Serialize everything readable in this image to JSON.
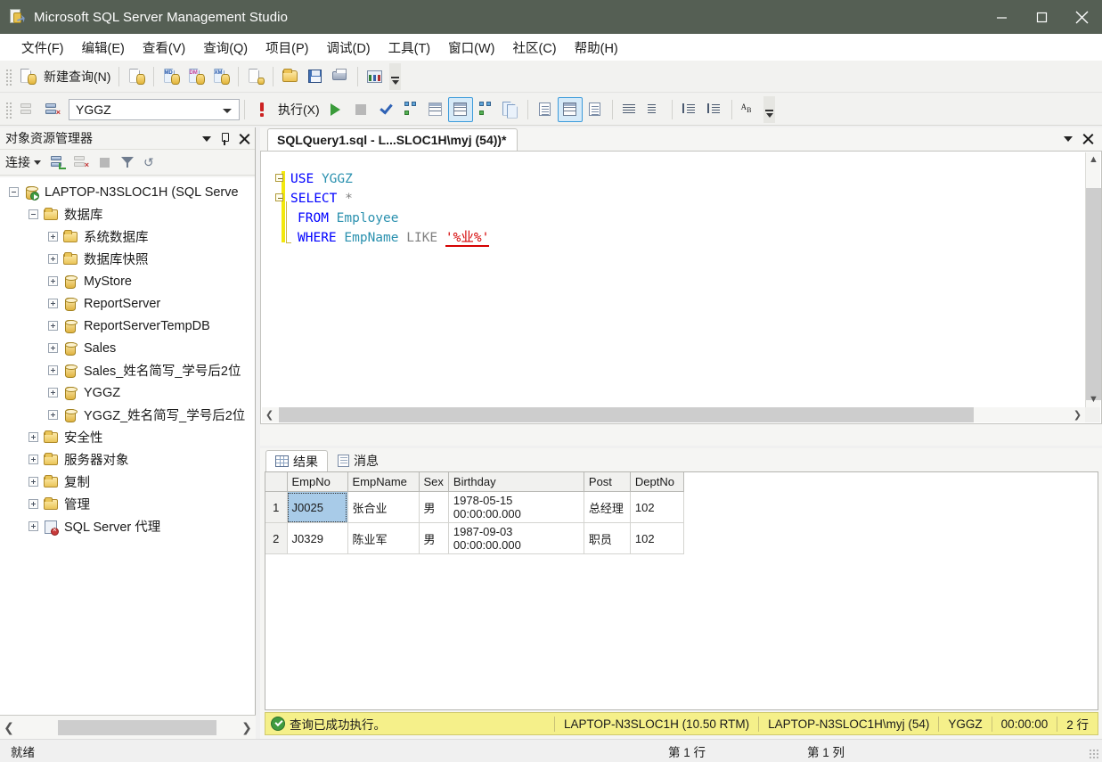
{
  "window": {
    "title": "Microsoft SQL Server Management Studio",
    "icon": "ssms-app-icon",
    "controls": {
      "minimize": "minimize-button",
      "maximize": "maximize-button",
      "close": "close-button"
    }
  },
  "menubar": {
    "items": [
      {
        "label": "文件(F)",
        "name": "menu-file"
      },
      {
        "label": "编辑(E)",
        "name": "menu-edit"
      },
      {
        "label": "查看(V)",
        "name": "menu-view"
      },
      {
        "label": "查询(Q)",
        "name": "menu-query"
      },
      {
        "label": "项目(P)",
        "name": "menu-project"
      },
      {
        "label": "调试(D)",
        "name": "menu-debug"
      },
      {
        "label": "工具(T)",
        "name": "menu-tools"
      },
      {
        "label": "窗口(W)",
        "name": "menu-window"
      },
      {
        "label": "社区(C)",
        "name": "menu-community"
      },
      {
        "label": "帮助(H)",
        "name": "menu-help"
      }
    ]
  },
  "toolbar_standard": {
    "new_query_label": "新建查询(N)",
    "icons": [
      "new-query-icon",
      "new-file-icon",
      "new-analysis-query-icon",
      "new-mdx-query-icon",
      "new-dmx-query-icon",
      "new-xmla-query-icon",
      "open-file-icon",
      "save-icon",
      "print-icon",
      "activity-monitor-icon",
      "toolbar-overflow-icon"
    ]
  },
  "toolbar_query": {
    "database_selector_value": "YGGZ",
    "execute_label": "执行(X)",
    "icons": [
      "available-databases-icon",
      "change-connection-icon",
      "execute-bang-icon",
      "execute-play-icon",
      "stop-icon",
      "parse-check-icon",
      "display-estimated-plan-icon",
      "query-options-icon",
      "results-to-grid-icon",
      "include-actual-plan-icon",
      "include-client-statistics-icon",
      "results-to-text-icon",
      "results-to-grid-selected-icon",
      "results-to-file-icon",
      "comment-icon",
      "uncomment-icon",
      "decrease-indent-icon",
      "increase-indent-icon",
      "find-replace-icon",
      "toolbar-overflow-icon"
    ]
  },
  "object_explorer": {
    "title": "对象资源管理器",
    "header_icons": [
      "window-dropdown-icon",
      "pin-icon",
      "close-icon"
    ],
    "toolbar": {
      "connect_label": "连接",
      "icons": [
        "connect-icon",
        "disconnect-icon",
        "stop-icon",
        "filter-icon",
        "refresh-icon"
      ]
    },
    "tree": [
      {
        "label": "LAPTOP-N3SLOC1H (SQL Serve",
        "indent": 0,
        "expander": "minus",
        "icon": "server-icon",
        "name": "tree-node-server"
      },
      {
        "label": "数据库",
        "indent": 1,
        "expander": "minus",
        "icon": "folder-icon",
        "name": "tree-node-databases"
      },
      {
        "label": "系统数据库",
        "indent": 2,
        "expander": "plus",
        "icon": "folder-icon",
        "name": "tree-node-system-databases"
      },
      {
        "label": "数据库快照",
        "indent": 2,
        "expander": "plus",
        "icon": "folder-icon",
        "name": "tree-node-database-snapshots"
      },
      {
        "label": "MyStore",
        "indent": 2,
        "expander": "plus",
        "icon": "database-icon",
        "name": "tree-node-mystore"
      },
      {
        "label": "ReportServer",
        "indent": 2,
        "expander": "plus",
        "icon": "database-icon",
        "name": "tree-node-reportserver"
      },
      {
        "label": "ReportServerTempDB",
        "indent": 2,
        "expander": "plus",
        "icon": "database-icon",
        "name": "tree-node-reportservertempdb"
      },
      {
        "label": "Sales",
        "indent": 2,
        "expander": "plus",
        "icon": "database-icon",
        "name": "tree-node-sales"
      },
      {
        "label": "Sales_姓名简写_学号后2位",
        "indent": 2,
        "expander": "plus",
        "icon": "database-icon",
        "name": "tree-node-sales-student"
      },
      {
        "label": "YGGZ",
        "indent": 2,
        "expander": "plus",
        "icon": "database-icon",
        "name": "tree-node-yggz"
      },
      {
        "label": "YGGZ_姓名简写_学号后2位",
        "indent": 2,
        "expander": "plus",
        "icon": "database-icon",
        "name": "tree-node-yggz-student"
      },
      {
        "label": "安全性",
        "indent": 1,
        "expander": "plus",
        "icon": "folder-icon",
        "name": "tree-node-security"
      },
      {
        "label": "服务器对象",
        "indent": 1,
        "expander": "plus",
        "icon": "folder-icon",
        "name": "tree-node-server-objects"
      },
      {
        "label": "复制",
        "indent": 1,
        "expander": "plus",
        "icon": "folder-icon",
        "name": "tree-node-replication"
      },
      {
        "label": "管理",
        "indent": 1,
        "expander": "plus",
        "icon": "folder-icon",
        "name": "tree-node-management"
      },
      {
        "label": "SQL Server 代理",
        "indent": 1,
        "expander": "plus",
        "icon": "sql-agent-icon",
        "name": "tree-node-sql-server-agent"
      }
    ]
  },
  "editor": {
    "tab_label": "SQLQuery1.sql - L...SLOC1H\\myj (54))*",
    "lines": [
      {
        "fold": "minus",
        "tokens": [
          {
            "t": "USE",
            "c": "kw"
          },
          {
            "t": " ",
            "c": "op"
          },
          {
            "t": "YGGZ",
            "c": "idn"
          }
        ]
      },
      {
        "fold": "minus",
        "tokens": [
          {
            "t": "SELECT",
            "c": "kw"
          },
          {
            "t": " ",
            "c": "op"
          },
          {
            "t": "*",
            "c": "op"
          }
        ]
      },
      {
        "fold": "none",
        "tokens": [
          {
            "t": "FROM",
            "c": "kw"
          },
          {
            "t": " ",
            "c": "op"
          },
          {
            "t": "Employee",
            "c": "idn"
          }
        ]
      },
      {
        "fold": "end",
        "tokens": [
          {
            "t": "WHERE",
            "c": "kw"
          },
          {
            "t": " ",
            "c": "op"
          },
          {
            "t": "EmpName",
            "c": "idn"
          },
          {
            "t": " ",
            "c": "op"
          },
          {
            "t": "LIKE",
            "c": "op"
          },
          {
            "t": " ",
            "c": "op"
          },
          {
            "t": "'%业%'",
            "c": "str sq"
          }
        ]
      }
    ],
    "full_text": "USE YGGZ\nSELECT *\n  FROM Employee\n  WHERE EmpName LIKE '%业%'"
  },
  "results": {
    "tabs": [
      {
        "label": "结果",
        "icon": "results-grid-icon",
        "active": true,
        "name": "tab-results"
      },
      {
        "label": "消息",
        "icon": "messages-icon",
        "active": false,
        "name": "tab-messages"
      }
    ],
    "columns": [
      "EmpNo",
      "EmpName",
      "Sex",
      "Birthday",
      "Post",
      "DeptNo"
    ],
    "rows": [
      {
        "num": "1",
        "cells": [
          "J0025",
          "张合业",
          "男",
          "1978-05-15 00:00:00.000",
          "总经理",
          "102"
        ]
      },
      {
        "num": "2",
        "cells": [
          "J0329",
          "陈业军",
          "男",
          "1987-09-03 00:00:00.000",
          "职员",
          "102"
        ]
      }
    ],
    "selected_cell": {
      "row": 0,
      "col": 0
    },
    "status": {
      "icon": "success-icon",
      "message": "查询已成功执行。",
      "server": "LAPTOP-N3SLOC1H (10.50 RTM)",
      "user": "LAPTOP-N3SLOC1H\\myj (54)",
      "database": "YGGZ",
      "elapsed": "00:00:00",
      "rowcount": "2 行"
    }
  },
  "statusbar": {
    "ready": "就绪",
    "line": "第 1 行",
    "column": "第 1 列"
  },
  "colors": {
    "titlebar": "#555f54",
    "accent_selected": "#3c9bdb",
    "status_yellow": "#f5f08a",
    "keyword_blue": "#0000ff",
    "identifier_teal": "#2b91af",
    "string_red": "#d40000",
    "change_bar_yellow": "#f2e80c",
    "grid_selection": "#a8cbe8"
  }
}
